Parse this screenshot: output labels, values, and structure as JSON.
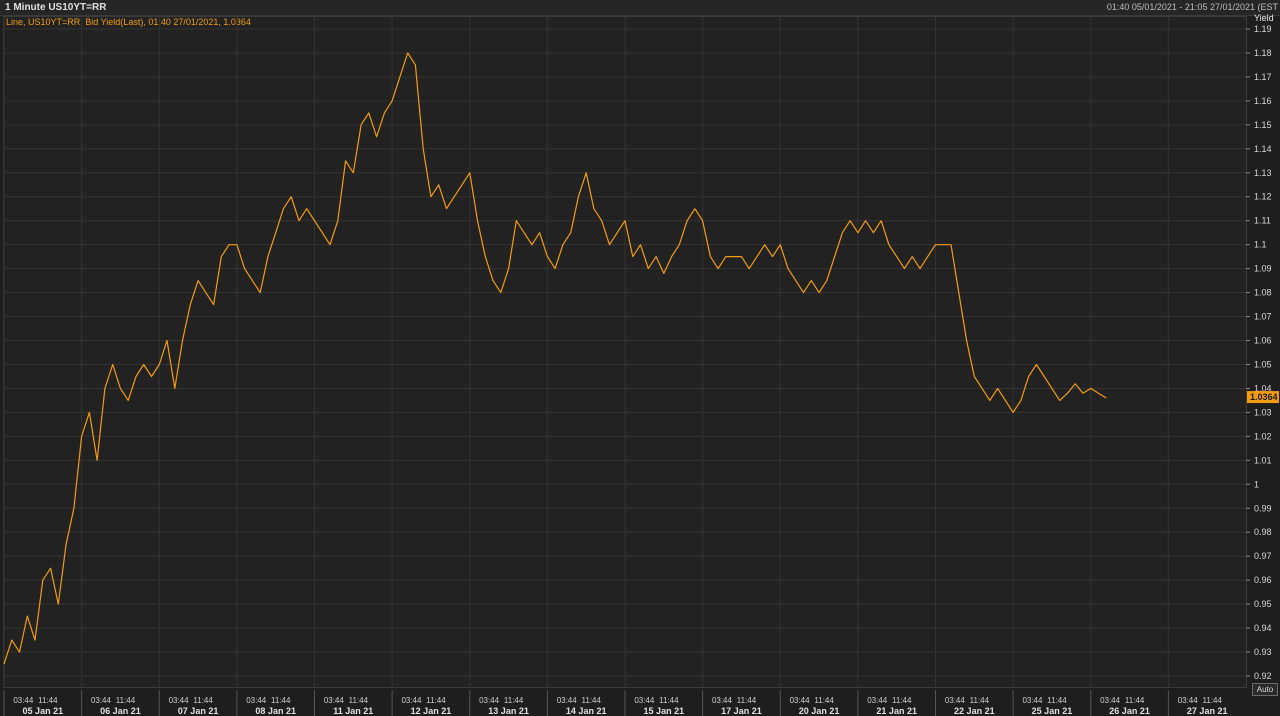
{
  "header": {
    "title": "1 Minute US10YT=RR",
    "date_range": "01:40 05/01/2021 - 21:05 27/01/2021 (EST"
  },
  "legend_text": "Line, US10YT=RR, Bid Yield(Last), 01:40 27/01/2021, 1.0364",
  "auto_label": "Auto",
  "colors": {
    "line": "#f39c12",
    "background": "#222222",
    "grid": "#333333",
    "last_tag": "#f39c12"
  },
  "chart_data": {
    "type": "line",
    "ylabel": "Yield",
    "ylim": [
      0.915,
      1.195
    ],
    "yticks": [
      0.92,
      0.93,
      0.94,
      0.95,
      0.96,
      0.97,
      0.98,
      0.99,
      1,
      1.01,
      1.02,
      1.03,
      1.04,
      1.05,
      1.06,
      1.07,
      1.08,
      1.09,
      1.1,
      1.11,
      1.12,
      1.13,
      1.14,
      1.15,
      1.16,
      1.17,
      1.18,
      1.19
    ],
    "ytick_labels": [
      "0.92",
      "0.93",
      "0.94",
      "0.95",
      "0.96",
      "0.97",
      "0.98",
      "0.99",
      "1",
      "1.01",
      "1.02",
      "1.03",
      "1.04",
      "1.05",
      "1.06",
      "1.07",
      "1.08",
      "1.09",
      "1.1",
      "1.11",
      "1.12",
      "1.13",
      "1.14",
      "1.15",
      "1.16",
      "1.17",
      "1.18",
      "1.19"
    ],
    "xlim": [
      0,
      16
    ],
    "day_labels": [
      "05 Jan 21",
      "06 Jan 21",
      "07 Jan 21",
      "08 Jan 21",
      "11 Jan 21",
      "12 Jan 21",
      "13 Jan 21",
      "14 Jan 21",
      "15 Jan 21",
      "17 Jan 21",
      "20 Jan 21",
      "21 Jan 21",
      "22 Jan 21",
      "25 Jan 21",
      "26 Jan 21",
      "27 Jan 21"
    ],
    "time_labels": [
      "03:44",
      "11:44"
    ],
    "last_value": "1.0364",
    "series": [
      {
        "values": [
          [
            0.0,
            0.925
          ],
          [
            0.1,
            0.935
          ],
          [
            0.2,
            0.93
          ],
          [
            0.3,
            0.945
          ],
          [
            0.4,
            0.935
          ],
          [
            0.5,
            0.96
          ],
          [
            0.6,
            0.965
          ],
          [
            0.7,
            0.95
          ],
          [
            0.8,
            0.975
          ],
          [
            0.9,
            0.99
          ],
          [
            1.0,
            1.02
          ],
          [
            1.1,
            1.03
          ],
          [
            1.2,
            1.01
          ],
          [
            1.3,
            1.04
          ],
          [
            1.4,
            1.05
          ],
          [
            1.5,
            1.04
          ],
          [
            1.6,
            1.035
          ],
          [
            1.7,
            1.045
          ],
          [
            1.8,
            1.05
          ],
          [
            1.9,
            1.045
          ],
          [
            2.0,
            1.05
          ],
          [
            2.1,
            1.06
          ],
          [
            2.2,
            1.04
          ],
          [
            2.3,
            1.06
          ],
          [
            2.4,
            1.075
          ],
          [
            2.5,
            1.085
          ],
          [
            2.6,
            1.08
          ],
          [
            2.7,
            1.075
          ],
          [
            2.8,
            1.095
          ],
          [
            2.9,
            1.1
          ],
          [
            3.0,
            1.1
          ],
          [
            3.1,
            1.09
          ],
          [
            3.2,
            1.085
          ],
          [
            3.3,
            1.08
          ],
          [
            3.4,
            1.095
          ],
          [
            3.5,
            1.105
          ],
          [
            3.6,
            1.115
          ],
          [
            3.7,
            1.12
          ],
          [
            3.8,
            1.11
          ],
          [
            3.9,
            1.115
          ],
          [
            4.0,
            1.11
          ],
          [
            4.1,
            1.105
          ],
          [
            4.2,
            1.1
          ],
          [
            4.3,
            1.11
          ],
          [
            4.4,
            1.135
          ],
          [
            4.5,
            1.13
          ],
          [
            4.6,
            1.15
          ],
          [
            4.7,
            1.155
          ],
          [
            4.8,
            1.145
          ],
          [
            4.9,
            1.155
          ],
          [
            5.0,
            1.16
          ],
          [
            5.1,
            1.17
          ],
          [
            5.2,
            1.18
          ],
          [
            5.3,
            1.175
          ],
          [
            5.4,
            1.14
          ],
          [
            5.5,
            1.12
          ],
          [
            5.6,
            1.125
          ],
          [
            5.7,
            1.115
          ],
          [
            5.8,
            1.12
          ],
          [
            5.9,
            1.125
          ],
          [
            6.0,
            1.13
          ],
          [
            6.1,
            1.11
          ],
          [
            6.2,
            1.095
          ],
          [
            6.3,
            1.085
          ],
          [
            6.4,
            1.08
          ],
          [
            6.5,
            1.09
          ],
          [
            6.6,
            1.11
          ],
          [
            6.7,
            1.105
          ],
          [
            6.8,
            1.1
          ],
          [
            6.9,
            1.105
          ],
          [
            7.0,
            1.095
          ],
          [
            7.1,
            1.09
          ],
          [
            7.2,
            1.1
          ],
          [
            7.3,
            1.105
          ],
          [
            7.4,
            1.12
          ],
          [
            7.5,
            1.13
          ],
          [
            7.6,
            1.115
          ],
          [
            7.7,
            1.11
          ],
          [
            7.8,
            1.1
          ],
          [
            7.9,
            1.105
          ],
          [
            8.0,
            1.11
          ],
          [
            8.1,
            1.095
          ],
          [
            8.2,
            1.1
          ],
          [
            8.3,
            1.09
          ],
          [
            8.4,
            1.095
          ],
          [
            8.5,
            1.088
          ],
          [
            8.6,
            1.095
          ],
          [
            8.7,
            1.1
          ],
          [
            8.8,
            1.11
          ],
          [
            8.9,
            1.115
          ],
          [
            9.0,
            1.11
          ],
          [
            9.1,
            1.095
          ],
          [
            9.2,
            1.09
          ],
          [
            9.3,
            1.095
          ],
          [
            9.4,
            1.095
          ],
          [
            9.5,
            1.095
          ],
          [
            9.6,
            1.09
          ],
          [
            9.7,
            1.095
          ],
          [
            9.8,
            1.1
          ],
          [
            9.9,
            1.095
          ],
          [
            10.0,
            1.1
          ],
          [
            10.1,
            1.09
          ],
          [
            10.2,
            1.085
          ],
          [
            10.3,
            1.08
          ],
          [
            10.4,
            1.085
          ],
          [
            10.5,
            1.08
          ],
          [
            10.6,
            1.085
          ],
          [
            10.7,
            1.095
          ],
          [
            10.8,
            1.105
          ],
          [
            10.9,
            1.11
          ],
          [
            11.0,
            1.105
          ],
          [
            11.1,
            1.11
          ],
          [
            11.2,
            1.105
          ],
          [
            11.3,
            1.11
          ],
          [
            11.4,
            1.1
          ],
          [
            11.5,
            1.095
          ],
          [
            11.6,
            1.09
          ],
          [
            11.7,
            1.095
          ],
          [
            11.8,
            1.09
          ],
          [
            11.9,
            1.095
          ],
          [
            12.0,
            1.1
          ],
          [
            12.1,
            1.1
          ],
          [
            12.2,
            1.1
          ],
          [
            12.3,
            1.08
          ],
          [
            12.4,
            1.06
          ],
          [
            12.5,
            1.045
          ],
          [
            12.6,
            1.04
          ],
          [
            12.7,
            1.035
          ],
          [
            12.8,
            1.04
          ],
          [
            12.9,
            1.035
          ],
          [
            13.0,
            1.03
          ],
          [
            13.1,
            1.035
          ],
          [
            13.2,
            1.045
          ],
          [
            13.3,
            1.05
          ],
          [
            13.4,
            1.045
          ],
          [
            13.5,
            1.04
          ],
          [
            13.6,
            1.035
          ],
          [
            13.7,
            1.038
          ],
          [
            13.8,
            1.042
          ],
          [
            13.9,
            1.038
          ],
          [
            14.0,
            1.04
          ],
          [
            14.1,
            1.038
          ],
          [
            14.2,
            1.036
          ]
        ]
      }
    ]
  }
}
